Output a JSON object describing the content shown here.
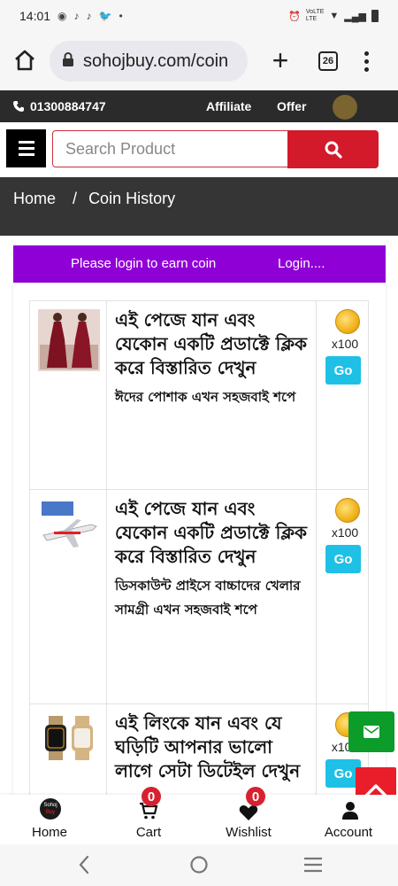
{
  "status_bar": {
    "time": "14:01",
    "network_label": "VoLTE",
    "network_sub": "LTE"
  },
  "browser": {
    "url": "sohojbuy.com/coin",
    "tab_count": "26"
  },
  "top_strip": {
    "phone": "01300884747",
    "affiliate_label": "Affiliate",
    "offer_label": "Offer"
  },
  "search": {
    "placeholder": "Search Product"
  },
  "breadcrumb": {
    "home": "Home",
    "separator": "/",
    "current": "Coin History"
  },
  "login_bar": {
    "message": "Please login to earn coin",
    "link": "Login...."
  },
  "coin_items": [
    {
      "title": "এই পেজে যান এবং যেকোন একটি প্রডাক্টে ক্লিক করে বিস্তারিত দেখুন",
      "subtitle": "ঈদের পোশাক এখন সহজবাই শপে",
      "coin_multiplier": "x100",
      "go_label": "Go"
    },
    {
      "title": "এই পেজে যান এবং যেকোন একটি প্রডাক্টে ক্লিক করে বিস্তারিত দেখুন",
      "subtitle": "ডিসকাউন্ট প্রাইসে বাচ্চাদের খেলার সামগ্রী এখন সহজবাই শপে",
      "coin_multiplier": "x100",
      "go_label": "Go"
    },
    {
      "title": "এই লিংকে যান এবং যে ঘড়িটি আপনার ভালো লাগে সেটা ডিটেইল দেখুন",
      "subtitle": "",
      "coin_multiplier": "x100",
      "go_label": "Go"
    }
  ],
  "bottom_nav": {
    "home_label": "Home",
    "logo_text_top": "Sohoj",
    "logo_text_bottom": "Buy",
    "cart_label": "Cart",
    "cart_count": "0",
    "wishlist_label": "Wishlist",
    "wishlist_count": "0",
    "account_label": "Account"
  },
  "colors": {
    "accent_red": "#d21a2a",
    "login_bar_purple": "#8f00d6",
    "go_button_cyan": "#1ec0e6",
    "message_green": "#0b9c2a",
    "dark_strip": "#2b2b2b"
  },
  "icons": [
    "home-icon",
    "lock-icon",
    "plus-icon",
    "tabs-icon",
    "more-vert-icon",
    "phone-icon",
    "hamburger-icon",
    "search-icon",
    "coin-icon",
    "mail-icon",
    "chevron-up-icon",
    "cart-icon",
    "heart-icon",
    "user-icon",
    "back-icon",
    "circle-home-icon",
    "recents-icon"
  ]
}
